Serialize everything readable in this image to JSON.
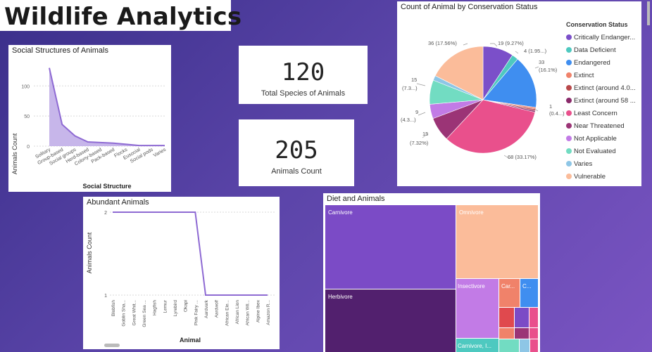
{
  "page": {
    "title": "Wildlife Analytics"
  },
  "kpis": [
    {
      "value": "120",
      "label": "Total Species of Animals"
    },
    {
      "value": "205",
      "label": "Animals Count"
    }
  ],
  "social_chart": {
    "title": "Social Structures of Animals",
    "ylabel": "Animals Count",
    "xlabel": "Social Structure",
    "yticks": [
      "0",
      "50",
      "100"
    ]
  },
  "abundant_chart": {
    "title": "Abundant Animals",
    "ylabel": "Animals Count",
    "xlabel": "Animal",
    "yticks": [
      "1",
      "2"
    ]
  },
  "pie_chart": {
    "title": "Count of Animal by Conservation Status",
    "legend_title": "Conservation Status",
    "labels": [
      {
        "text": "19 (9.27%)"
      },
      {
        "text": "4 (1.95...)"
      },
      {
        "text": "33"
      },
      {
        "text": "(16.1%)"
      },
      {
        "text": "1"
      },
      {
        "text": "(0.4...)"
      },
      {
        "text": "68 (33.17%)"
      },
      {
        "text": "15"
      },
      {
        "text": "(7.32%)"
      },
      {
        "text": "9"
      },
      {
        "text": "(4.3...)"
      },
      {
        "text": "15"
      },
      {
        "text": "(7.3...)"
      },
      {
        "text": "36 (17.56%)"
      }
    ]
  },
  "treemap": {
    "title": "Diet and Animals",
    "labels": [
      "Carnivore",
      "Omnivore",
      "Herbivore",
      "Insectivore",
      "Car...",
      "C...",
      "Carnivore, I..."
    ]
  },
  "chart_data": [
    {
      "type": "area",
      "title": "Social Structures of Animals",
      "xlabel": "Social Structure",
      "ylabel": "Animals Count",
      "categories": [
        "Solitary",
        "Group-based",
        "Social groups",
        "Herd-based",
        "Colony-based",
        "Pack-based",
        "Flocks",
        "Eusocial",
        "Social pods",
        "Varies"
      ],
      "values": [
        130,
        36,
        17,
        7,
        6,
        5,
        3,
        1,
        1,
        1
      ],
      "ylim": [
        0,
        140
      ],
      "grid": true
    },
    {
      "type": "line",
      "title": "Abundant Animals",
      "xlabel": "Animal",
      "ylabel": "Animals Count",
      "categories": [
        "Blobfish",
        "Goblin Sha...",
        "Great Whit...",
        "Green Sea ...",
        "Hagfish",
        "Lemur",
        "Lyrebird",
        "Okapi",
        "Pink Fairy ...",
        "Aardvark",
        "Aardwolf",
        "African Ele...",
        "African Lion",
        "African Wil...",
        "Alpine Ibex",
        "Amazon R..."
      ],
      "values": [
        2,
        2,
        2,
        2,
        2,
        2,
        2,
        2,
        2,
        1,
        1,
        1,
        1,
        1,
        1,
        1
      ],
      "ylim": [
        1,
        2
      ],
      "grid": true
    },
    {
      "type": "pie",
      "title": "Count of Animal by Conservation Status",
      "legend_title": "Conservation Status",
      "legend_position": "right",
      "categories": [
        "Critically Endanger...",
        "Data Deficient",
        "Endangered",
        "Extinct",
        "Extinct (around 4.0...",
        "Extinct (around 58 ...",
        "Least Concern",
        "Near Threatened",
        "Not Applicable",
        "Not Evaluated",
        "Varies",
        "Vulnerable"
      ],
      "values": [
        19,
        4,
        33,
        1,
        1,
        1,
        68,
        15,
        9,
        15,
        3,
        36
      ],
      "colors": [
        "#7b4fc9",
        "#4ec9c0",
        "#3f8ef0",
        "#f0826a",
        "#b8484a",
        "#8a2a6a",
        "#e9508c",
        "#9b3476",
        "#c27be6",
        "#72dcc2",
        "#8ec6e6",
        "#fbbc9a"
      ]
    },
    {
      "type": "treemap",
      "title": "Diet and Animals",
      "categories": [
        "Carnivore",
        "Omnivore",
        "Herbivore",
        "Insectivore",
        "Car...",
        "C...",
        "Carnivore, I..."
      ]
    }
  ]
}
